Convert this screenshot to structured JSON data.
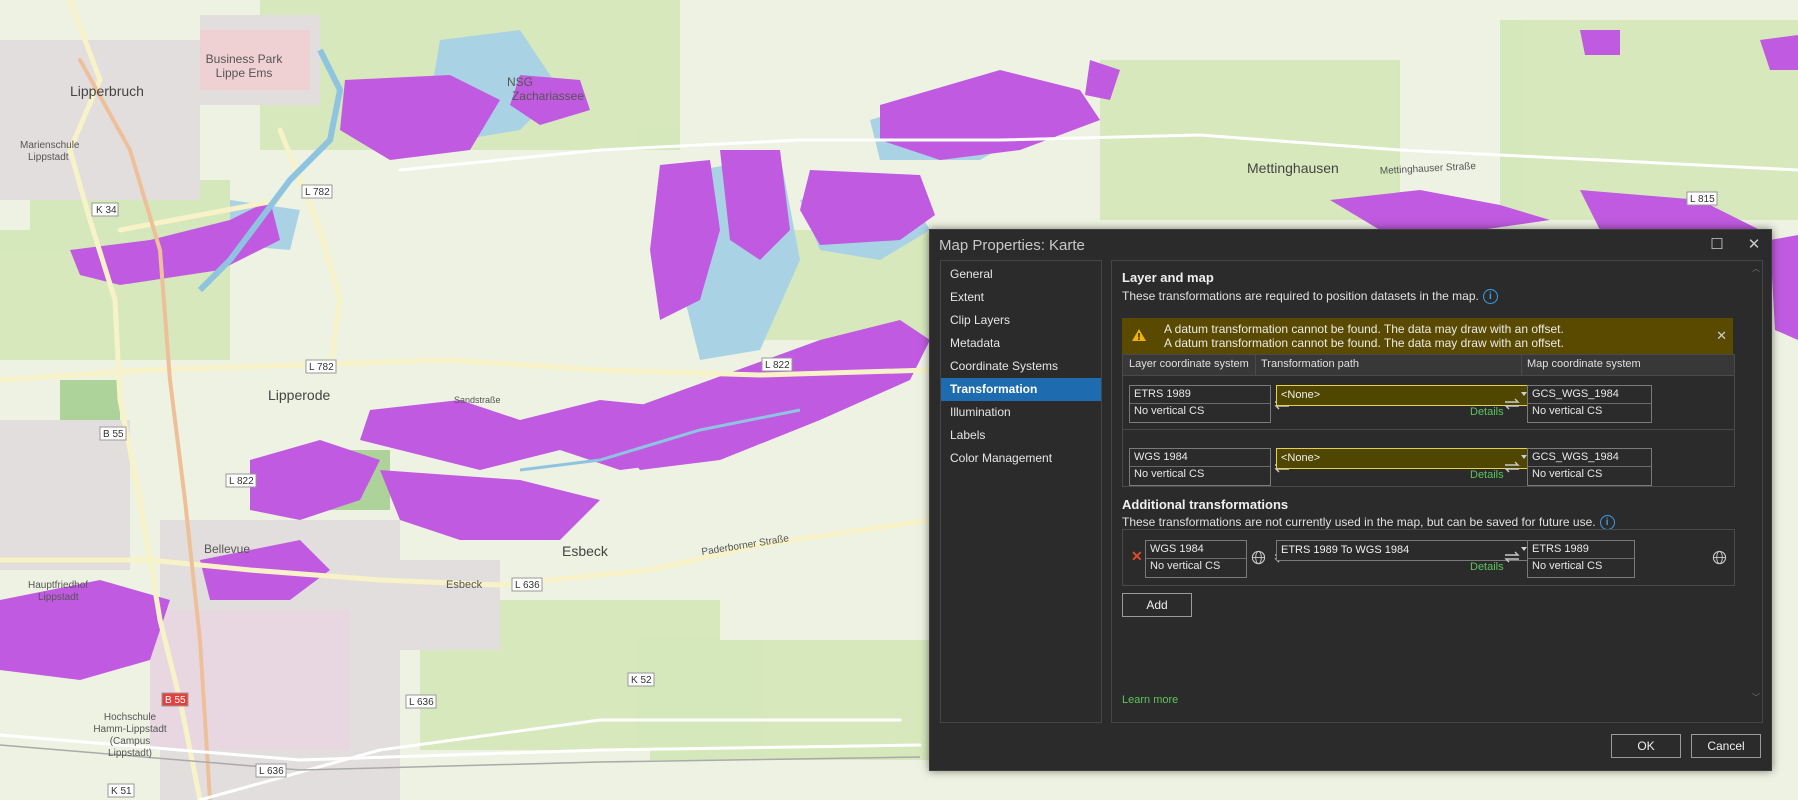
{
  "map": {
    "places": [
      {
        "name": "Business Park\nLippe Ems"
      },
      {
        "name": "Lipperbruch"
      },
      {
        "name": "NSG\nZachariassee"
      },
      {
        "name": "Marienschule\nLippstadt"
      },
      {
        "name": "Lipperode"
      },
      {
        "name": "Bellevue"
      },
      {
        "name": "Esbeck"
      },
      {
        "name": "Hauptfriedhof\nLippstadt"
      },
      {
        "name": "Hochschule\nHamm-Lippstadt\n(Campus\nLippstadt)"
      },
      {
        "name": "Mettinghausen"
      },
      {
        "name": "Sandstraße"
      },
      {
        "name": "Paderborner Straße"
      },
      {
        "name": "Mettinghauser Straße"
      },
      {
        "name": "Esbeck"
      }
    ],
    "roads": [
      "K 34",
      "L 782",
      "L 782",
      "L 822",
      "L 822",
      "B 55",
      "B 55",
      "L 636",
      "L 636",
      "L 636",
      "K 52",
      "K 51",
      "L 815"
    ]
  },
  "dialog": {
    "title": "Map Properties: Karte",
    "nav": [
      "General",
      "Extent",
      "Clip Layers",
      "Metadata",
      "Coordinate Systems",
      "Transformation",
      "Illumination",
      "Labels",
      "Color Management"
    ],
    "active_nav": "Transformation",
    "layer_section": {
      "heading": "Layer and map",
      "description": "These transformations are required to position datasets in the map.",
      "warning_lines": [
        "A datum transformation cannot be found. The data may draw with an offset.",
        "A datum transformation cannot be found. The data may draw with an offset."
      ],
      "columns": [
        "Layer coordinate system",
        "Transformation path",
        "Map coordinate system"
      ],
      "rows": [
        {
          "layer_cs": "ETRS 1989",
          "layer_vcs": "No vertical CS",
          "path": "<None>",
          "details": "Details",
          "map_cs": "GCS_WGS_1984",
          "map_vcs": "No vertical CS"
        },
        {
          "layer_cs": "WGS 1984",
          "layer_vcs": "No vertical CS",
          "path": "<None>",
          "details": "Details",
          "map_cs": "GCS_WGS_1984",
          "map_vcs": "No vertical CS"
        }
      ]
    },
    "additional_section": {
      "heading": "Additional transformations",
      "description": "These transformations are not currently used in the map, but can be saved for future use.",
      "row": {
        "from_cs": "WGS 1984",
        "from_vcs": "No vertical CS",
        "path": "ETRS 1989 To WGS 1984",
        "details": "Details",
        "to_cs": "ETRS 1989",
        "to_vcs": "No vertical CS"
      },
      "add_label": "Add"
    },
    "learn_more": "Learn more",
    "ok_label": "OK",
    "cancel_label": "Cancel"
  }
}
